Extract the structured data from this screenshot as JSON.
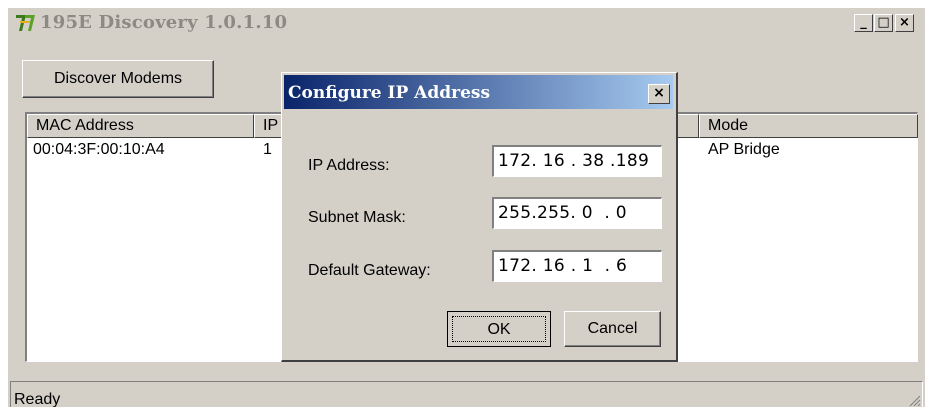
{
  "window": {
    "title": "195E Discovery 1.0.1.10",
    "minimize": "_",
    "maximize": "□",
    "close": "×"
  },
  "toolbar": {
    "discover_label": "Discover Modems"
  },
  "list": {
    "headers": {
      "mac": "MAC Address",
      "ip": "IP",
      "mode": "Mode"
    },
    "rows": [
      {
        "mac": "00:04:3F:00:10:A4",
        "ip": "1",
        "mode": "AP Bridge"
      }
    ]
  },
  "status": {
    "text": "Ready"
  },
  "dialog": {
    "title": "Configure IP Address",
    "close": "×",
    "ip_label": "IP Address:",
    "ip_value": "172. 16 . 38 .189",
    "subnet_label": "Subnet Mask:",
    "subnet_value": "255.255. 0  . 0",
    "gateway_label": "Default Gateway:",
    "gateway_value": "172. 16 . 1  . 6",
    "ok_label": "OK",
    "cancel_label": "Cancel"
  },
  "colors": {
    "face": "#d4d0c8",
    "dialog_title_start": "#0a246a",
    "dialog_title_end": "#a6caf0"
  }
}
